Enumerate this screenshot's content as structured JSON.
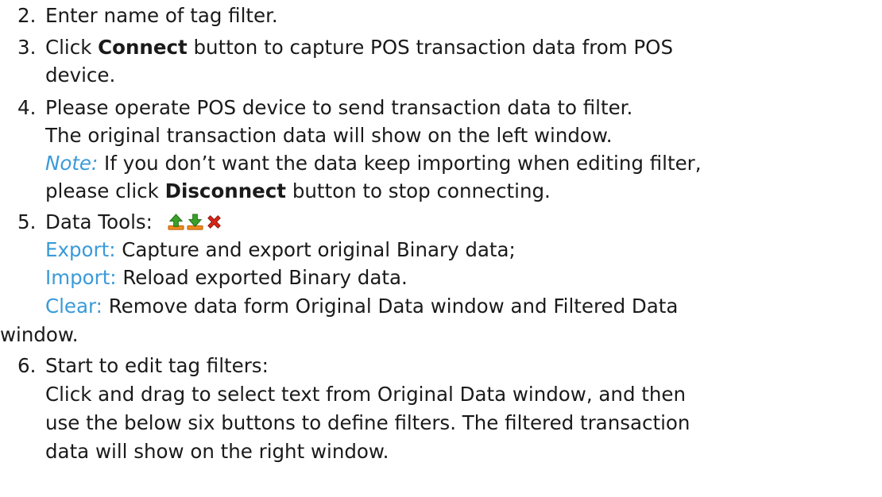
{
  "steps": {
    "s2": {
      "num": "2.",
      "text": "Enter name of tag filter."
    },
    "s3": {
      "num": "3.",
      "pre": "Click ",
      "bold": "Connect",
      "post": " button to capture POS transaction data from POS",
      "cont": "device."
    },
    "s4": {
      "num": "4.",
      "line1": "Please operate POS device to send transaction data to filter.",
      "line2": "The original transaction data will show on the left window.",
      "note_label": "Note:",
      "note_text": " If you don’t want the data keep importing when editing filter,",
      "line4_pre": "please click ",
      "line4_bold": "Disconnect",
      "line4_post": " button to stop connecting."
    },
    "s5": {
      "num": "5.",
      "title": "Data Tools:",
      "export_label": "Export:",
      "export_text": " Capture and export original Binary data;",
      "import_label": "Import:",
      "import_text": " Reload exported Binary data.",
      "clear_label": "Clear:",
      "clear_text": " Remove data form Original Data window and Filtered Data",
      "clear_cont": "window."
    },
    "s6": {
      "num": "6.",
      "title": "Start to edit tag filters:",
      "line1": "Click and drag to select text from Original Data window, and then",
      "line2": "use the below six buttons to define filters. The filtered transaction",
      "line3": "data will show on the right window."
    }
  },
  "icons": {
    "export": "export-up-arrow-icon",
    "import": "import-down-arrow-icon",
    "clear": "clear-x-icon"
  },
  "colors": {
    "text": "#1a1a1a",
    "accent_blue": "#3a9ad9",
    "icon_green": "#3aa02a",
    "icon_orange": "#f08a1c",
    "icon_red": "#d8261a"
  }
}
